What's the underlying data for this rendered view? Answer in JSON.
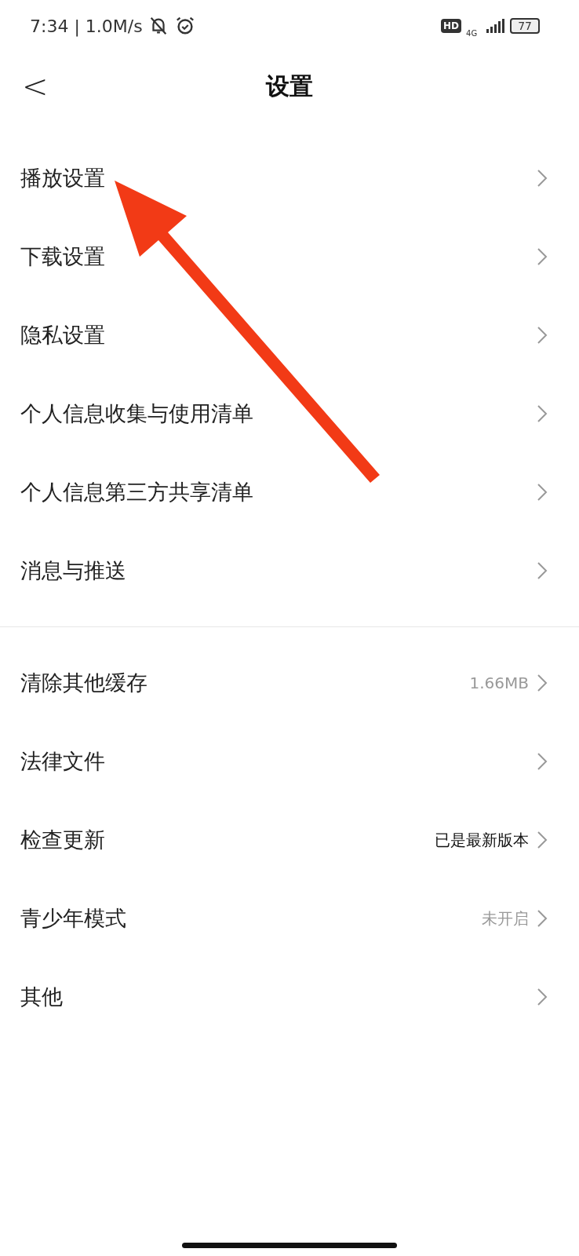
{
  "status_bar": {
    "time": "7:34 | 1.0M/s",
    "network": "4G",
    "hd": "HD",
    "battery": "77"
  },
  "header": {
    "back": "<",
    "title": "设置"
  },
  "sections": [
    {
      "items": [
        {
          "label": "播放设置"
        },
        {
          "label": "下载设置"
        },
        {
          "label": "隐私设置"
        },
        {
          "label": "个人信息收集与使用清单"
        },
        {
          "label": "个人信息第三方共享清单"
        },
        {
          "label": "消息与推送"
        }
      ]
    },
    {
      "items": [
        {
          "label": "清除其他缓存",
          "value": "1.66MB",
          "emphasized": false
        },
        {
          "label": "法律文件"
        },
        {
          "label": "检查更新",
          "value": "已是最新版本",
          "emphasized": true
        },
        {
          "label": "青少年模式",
          "value": "未开启",
          "emphasized": false
        },
        {
          "label": "其他"
        }
      ]
    }
  ]
}
